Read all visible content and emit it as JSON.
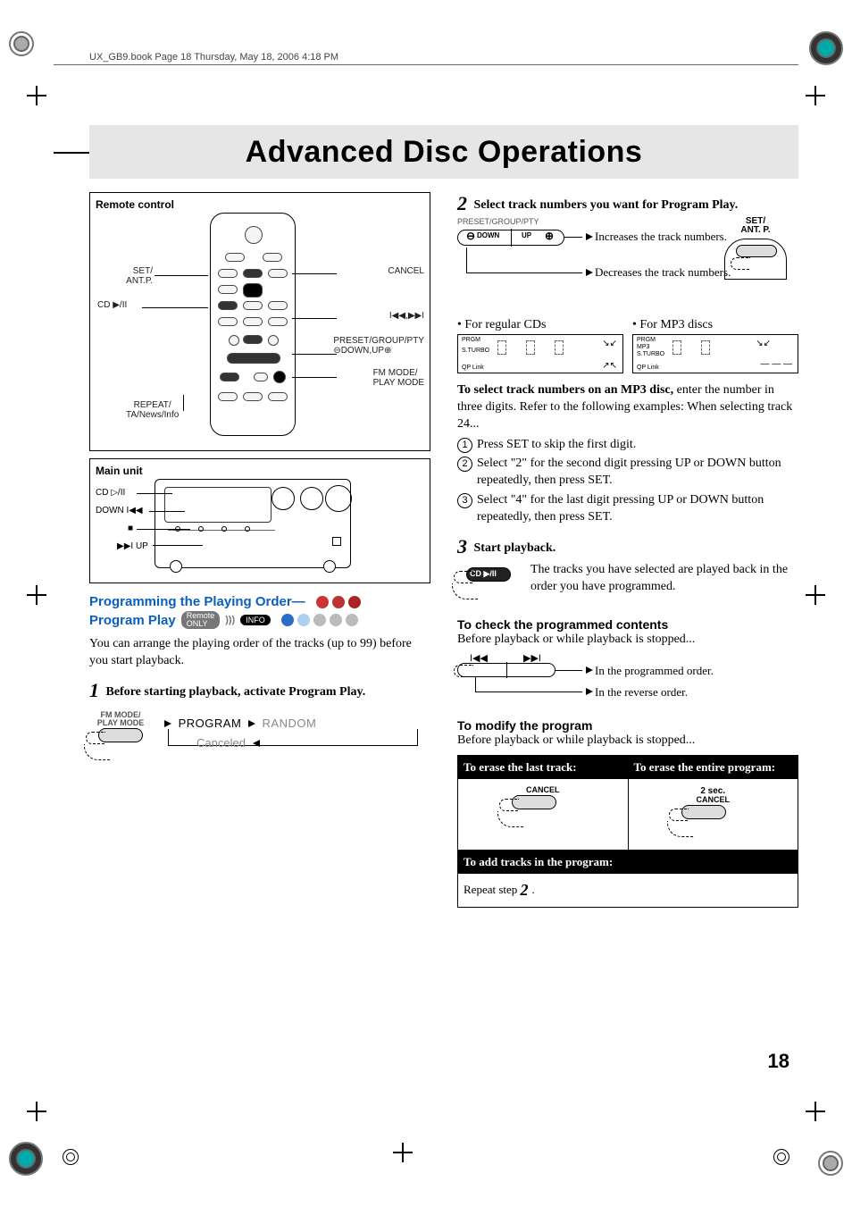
{
  "header_path": "UX_GB9.book  Page 18  Thursday, May 18, 2006  4:18 PM",
  "title": "Advanced Disc Operations",
  "page_number": "18",
  "left": {
    "remote_title": "Remote control",
    "main_unit_title": "Main unit",
    "rc_labels": {
      "set": "SET/\nANT.P.",
      "cd": "CD ▶/II",
      "cancel": "CANCEL",
      "skip": "I◀◀,▶▶I",
      "preset": "PRESET/GROUP/PTY\n⊖DOWN,UP⊕",
      "fm": "FM MODE/\nPLAY MODE",
      "repeat": "REPEAT/\nTA/News/Info"
    },
    "mu_labels": {
      "cd": "CD ▷/II",
      "down": "DOWN I◀◀",
      "stop": "■",
      "up": "▶▶I UP"
    },
    "section_line1": "Programming the Playing Order—",
    "section_line2": "Program Play",
    "badge_remote": "Remote\nONLY",
    "badge_info": "INFO",
    "intro": "You can arrange the playing order of the tracks (up to 99) before you start playback.",
    "step1": "Before starting playback, activate Program Play.",
    "step1_btn_caption": "FM MODE/\nPLAY MODE",
    "flow_program": "PROGRAM",
    "flow_random": "RANDOM",
    "flow_canceled": "Canceled"
  },
  "right": {
    "step2": "Select track numbers you want for Program Play.",
    "updown_caption": "PRESET/GROUP/PTY",
    "down": "DOWN",
    "up": "UP",
    "inc": "Increases the track numbers.",
    "dec": "Decreases the track numbers.",
    "set_caption": "SET/\nANT. P.",
    "for_cd": "• For regular CDs",
    "for_mp3": "• For MP3 discs",
    "lcd1": {
      "prgm": "PRGM",
      "sturbo": "S.TURBO",
      "qp": "QP Link"
    },
    "lcd2": {
      "prgm": "PRGM",
      "mp3": "MP3",
      "sturbo": "S.TURBO",
      "qp": "QP Link"
    },
    "mp3_lead": "To select track numbers on an MP3 disc,",
    "mp3_rest": " enter the number in three digits. Refer to the following examples: When selecting track 24...",
    "li1": "Press SET to skip the first digit.",
    "li2": "Select \"2\" for the second digit pressing UP or DOWN button repeatedly, then press SET.",
    "li3": "Select \"4\" for the last digit pressing UP or DOWN button repeatedly, then press SET.",
    "step3": "Start playback.",
    "step3_btn": "CD ▶/II",
    "step3_text": "The tracks you have selected are played back in the order you have programmed.",
    "check_head": "To check the programmed contents",
    "check_intro": "Before playback or while playback is stopped...",
    "check_prog": "In the programmed order.",
    "check_rev": "In the reverse order.",
    "check_prev": "I◀◀",
    "check_next": "▶▶I",
    "mod_head": "To modify the program",
    "mod_intro": "Before playback or while playback is stopped...",
    "th1": "To erase the last track:",
    "th2": "To erase the entire program:",
    "cancel": "CANCEL",
    "two_sec": "2 sec.",
    "th3": "To add tracks in the program:",
    "repeat_step": "Repeat step ",
    "repeat_step_num": "2",
    "repeat_step_dot": "."
  }
}
